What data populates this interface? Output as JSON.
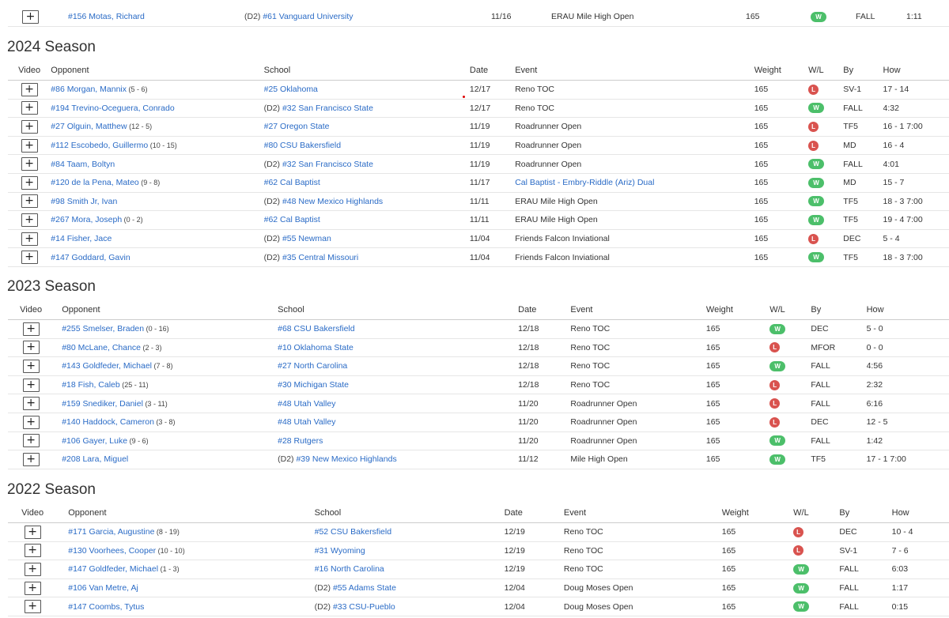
{
  "headers": {
    "video": "Video",
    "opponent": "Opponent",
    "school": "School",
    "date": "Date",
    "event": "Event",
    "weight": "Weight",
    "wl": "W/L",
    "by": "By",
    "how": "How"
  },
  "top_row": {
    "opponent": "#156 Motas, Richard",
    "division": "(D2)",
    "school": "#61 Vanguard University",
    "date": "11/16",
    "event": "ERAU Mile High Open",
    "weight": "165",
    "wl": "W",
    "by": "FALL",
    "how": "1:11"
  },
  "seasons": [
    {
      "title": "2024 Season",
      "rows": [
        {
          "opponent": "#86 Morgan, Mannix",
          "record": "(5 - 6)",
          "division": "",
          "school": "#25 Oklahoma",
          "date": "12/17",
          "event": "Reno TOC",
          "event_link": false,
          "weight": "165",
          "wl": "L",
          "by": "SV-1",
          "how": "17 - 14"
        },
        {
          "opponent": "#194 Trevino-Oceguera, Conrado",
          "record": "",
          "division": "(D2)",
          "school": "#32 San Francisco State",
          "date": "12/17",
          "event": "Reno TOC",
          "event_link": false,
          "weight": "165",
          "wl": "W",
          "by": "FALL",
          "how": "4:32"
        },
        {
          "opponent": "#27 Olguin, Matthew",
          "record": "(12 - 5)",
          "division": "",
          "school": "#27 Oregon State",
          "date": "11/19",
          "event": "Roadrunner Open",
          "event_link": false,
          "weight": "165",
          "wl": "L",
          "by": "TF5",
          "how": "16 - 1 7:00"
        },
        {
          "opponent": "#112 Escobedo, Guillermo",
          "record": "(10 - 15)",
          "division": "",
          "school": "#80 CSU Bakersfield",
          "date": "11/19",
          "event": "Roadrunner Open",
          "event_link": false,
          "weight": "165",
          "wl": "L",
          "by": "MD",
          "how": "16 - 4"
        },
        {
          "opponent": "#84 Taam, Boltyn",
          "record": "",
          "division": "(D2)",
          "school": "#32 San Francisco State",
          "date": "11/19",
          "event": "Roadrunner Open",
          "event_link": false,
          "weight": "165",
          "wl": "W",
          "by": "FALL",
          "how": "4:01"
        },
        {
          "opponent": "#120 de la Pena, Mateo",
          "record": "(9 - 8)",
          "division": "",
          "school": "#62 Cal Baptist",
          "date": "11/17",
          "event": "Cal Baptist - Embry-Riddle (Ariz) Dual",
          "event_link": true,
          "weight": "165",
          "wl": "W",
          "by": "MD",
          "how": "15 - 7"
        },
        {
          "opponent": "#98 Smith Jr, Ivan",
          "record": "",
          "division": "(D2)",
          "school": "#48 New Mexico Highlands",
          "date": "11/11",
          "event": "ERAU Mile High Open",
          "event_link": false,
          "weight": "165",
          "wl": "W",
          "by": "TF5",
          "how": "18 - 3 7:00"
        },
        {
          "opponent": "#267 Mora, Joseph",
          "record": "(0 - 2)",
          "division": "",
          "school": "#62 Cal Baptist",
          "date": "11/11",
          "event": "ERAU Mile High Open",
          "event_link": false,
          "weight": "165",
          "wl": "W",
          "by": "TF5",
          "how": "19 - 4 7:00"
        },
        {
          "opponent": "#14 Fisher, Jace",
          "record": "",
          "division": "(D2)",
          "school": "#55 Newman",
          "date": "11/04",
          "event": "Friends Falcon Inviational",
          "event_link": false,
          "weight": "165",
          "wl": "L",
          "by": "DEC",
          "how": "5 - 4"
        },
        {
          "opponent": "#147 Goddard, Gavin",
          "record": "",
          "division": "(D2)",
          "school": "#35 Central Missouri",
          "date": "11/04",
          "event": "Friends Falcon Inviational",
          "event_link": false,
          "weight": "165",
          "wl": "W",
          "by": "TF5",
          "how": "18 - 3 7:00"
        }
      ]
    },
    {
      "title": "2023 Season",
      "rows": [
        {
          "opponent": "#255 Smelser, Braden",
          "record": "(0 - 16)",
          "division": "",
          "school": "#68 CSU Bakersfield",
          "date": "12/18",
          "event": "Reno TOC",
          "event_link": false,
          "weight": "165",
          "wl": "W",
          "by": "DEC",
          "how": "5 - 0"
        },
        {
          "opponent": "#80 McLane, Chance",
          "record": "(2 - 3)",
          "division": "",
          "school": "#10 Oklahoma State",
          "date": "12/18",
          "event": "Reno TOC",
          "event_link": false,
          "weight": "165",
          "wl": "L",
          "by": "MFOR",
          "how": "0 - 0"
        },
        {
          "opponent": "#143 Goldfeder, Michael",
          "record": "(7 - 8)",
          "division": "",
          "school": "#27 North Carolina",
          "date": "12/18",
          "event": "Reno TOC",
          "event_link": false,
          "weight": "165",
          "wl": "W",
          "by": "FALL",
          "how": "4:56"
        },
        {
          "opponent": "#18 Fish, Caleb",
          "record": "(25 - 11)",
          "division": "",
          "school": "#30 Michigan State",
          "date": "12/18",
          "event": "Reno TOC",
          "event_link": false,
          "weight": "165",
          "wl": "L",
          "by": "FALL",
          "how": "2:32"
        },
        {
          "opponent": "#159 Snediker, Daniel",
          "record": "(3 - 11)",
          "division": "",
          "school": "#48 Utah Valley",
          "date": "11/20",
          "event": "Roadrunner Open",
          "event_link": false,
          "weight": "165",
          "wl": "L",
          "by": "FALL",
          "how": "6:16"
        },
        {
          "opponent": "#140 Haddock, Cameron",
          "record": "(3 - 8)",
          "division": "",
          "school": "#48 Utah Valley",
          "date": "11/20",
          "event": "Roadrunner Open",
          "event_link": false,
          "weight": "165",
          "wl": "L",
          "by": "DEC",
          "how": "12 - 5"
        },
        {
          "opponent": "#106 Gayer, Luke",
          "record": "(9 - 6)",
          "division": "",
          "school": "#28 Rutgers",
          "date": "11/20",
          "event": "Roadrunner Open",
          "event_link": false,
          "weight": "165",
          "wl": "W",
          "by": "FALL",
          "how": "1:42"
        },
        {
          "opponent": "#208 Lara, Miguel",
          "record": "",
          "division": "(D2)",
          "school": "#39 New Mexico Highlands",
          "date": "11/12",
          "event": "Mile High Open",
          "event_link": false,
          "weight": "165",
          "wl": "W",
          "by": "TF5",
          "how": "17 - 1 7:00"
        }
      ]
    },
    {
      "title": "2022 Season",
      "rows": [
        {
          "opponent": "#171 Garcia, Augustine",
          "record": "(8 - 19)",
          "division": "",
          "school": "#52 CSU Bakersfield",
          "date": "12/19",
          "event": "Reno TOC",
          "event_link": false,
          "weight": "165",
          "wl": "L",
          "by": "DEC",
          "how": "10 - 4"
        },
        {
          "opponent": "#130 Voorhees, Cooper",
          "record": "(10 - 10)",
          "division": "",
          "school": "#31 Wyoming",
          "date": "12/19",
          "event": "Reno TOC",
          "event_link": false,
          "weight": "165",
          "wl": "L",
          "by": "SV-1",
          "how": "7 - 6"
        },
        {
          "opponent": "#147 Goldfeder, Michael",
          "record": "(1 - 3)",
          "division": "",
          "school": "#16 North Carolina",
          "date": "12/19",
          "event": "Reno TOC",
          "event_link": false,
          "weight": "165",
          "wl": "W",
          "by": "FALL",
          "how": "6:03"
        },
        {
          "opponent": "#106 Van Metre, Aj",
          "record": "",
          "division": "(D2)",
          "school": "#55 Adams State",
          "date": "12/04",
          "event": "Doug Moses Open",
          "event_link": false,
          "weight": "165",
          "wl": "W",
          "by": "FALL",
          "how": "1:17"
        },
        {
          "opponent": "#147 Coombs, Tytus",
          "record": "",
          "division": "(D2)",
          "school": "#33 CSU-Pueblo",
          "date": "12/04",
          "event": "Doug Moses Open",
          "event_link": false,
          "weight": "165",
          "wl": "W",
          "by": "FALL",
          "how": "0:15"
        }
      ]
    }
  ],
  "colors": {
    "link": "#2a6bc6",
    "win": "#4cbf6a",
    "loss": "#d9534f"
  },
  "icons": {
    "expand": "plus-icon"
  }
}
